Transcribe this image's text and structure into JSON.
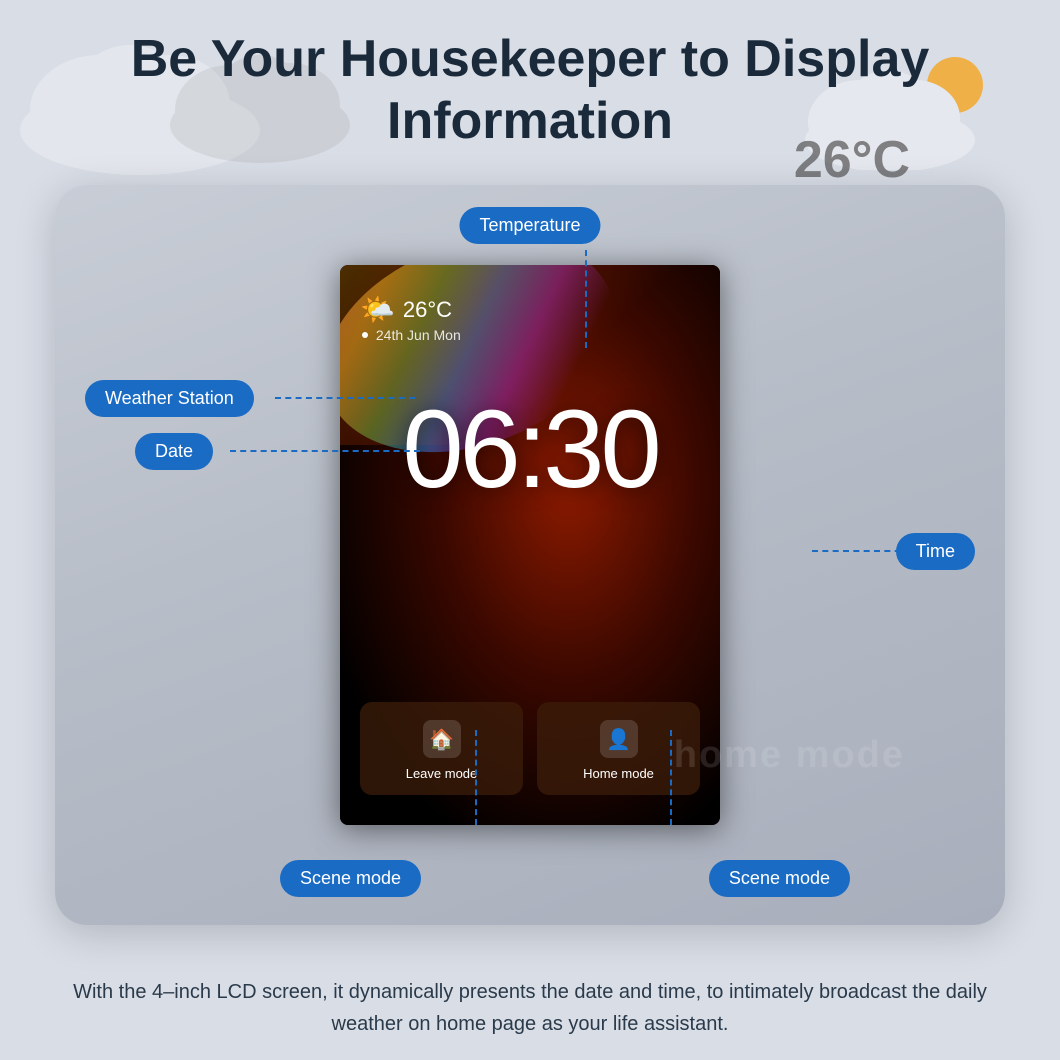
{
  "page": {
    "title_line1": "Be Your Housekeeper to Display",
    "title_line2": "Information",
    "bg_temp": "26°C",
    "description": "With the 4–inch LCD screen, it dynamically presents the date and time, to intimately broadcast the daily weather on home page as your life assistant."
  },
  "screen": {
    "weather_temp": "26°C",
    "date": "24th Jun  Mon",
    "time": "06:30",
    "scene1_label": "Leave mode",
    "scene2_label": "Home mode"
  },
  "annotations": {
    "temperature": "Temperature",
    "weather_station": "Weather Station",
    "date": "Date",
    "time": "Time",
    "scene_mode_1": "Scene mode",
    "scene_mode_2": "Scene mode"
  },
  "colors": {
    "annotation_bg": "#1a6bc4",
    "annotation_text": "#ffffff",
    "line_color": "#1a6bc4"
  }
}
